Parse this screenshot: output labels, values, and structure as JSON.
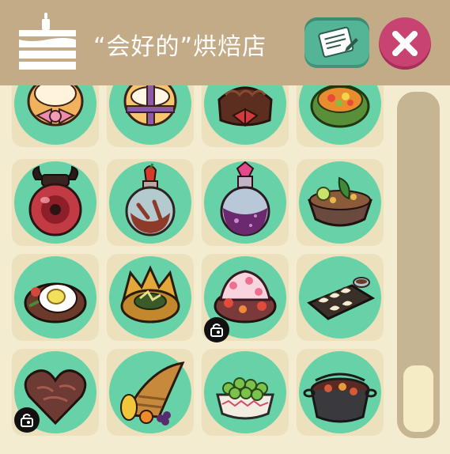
{
  "window": {
    "title": "“会好的”烘焙店"
  },
  "header": {
    "icon": "cake-icon",
    "notes_icon": "notes-icon",
    "close_icon": "close-icon"
  },
  "colors": {
    "header_bg": "#c4ab88",
    "panel_bg": "#f3ecd1",
    "cell_bg": "#ece0bd",
    "disc_green": "#67d2a7",
    "notes_button": "#53b496",
    "close_button": "#c94372"
  },
  "items": [
    {
      "name": "cream-puff-pink-bow",
      "locked": false
    },
    {
      "name": "cream-puff-purple-ribbon",
      "locked": false
    },
    {
      "name": "chocolate-cake-red-bow",
      "locked": false
    },
    {
      "name": "pumpkin-vegetable-dish",
      "locked": false
    },
    {
      "name": "horned-red-potion",
      "locked": false
    },
    {
      "name": "chili-potion-jar",
      "locked": false
    },
    {
      "name": "purple-gem-potion",
      "locked": false
    },
    {
      "name": "vegetable-soup-bowl",
      "locked": false
    },
    {
      "name": "fried-egg-plate",
      "locked": false
    },
    {
      "name": "crown-pie",
      "locked": false
    },
    {
      "name": "strawberry-cream-cake",
      "locked": true
    },
    {
      "name": "dumpling-tray",
      "locked": false
    },
    {
      "name": "chocolate-heart",
      "locked": true
    },
    {
      "name": "cornucopia",
      "locked": false
    },
    {
      "name": "pea-bowl",
      "locked": false
    },
    {
      "name": "stew-pot",
      "locked": false
    }
  ],
  "scrollbar": {
    "position": 0.92
  }
}
